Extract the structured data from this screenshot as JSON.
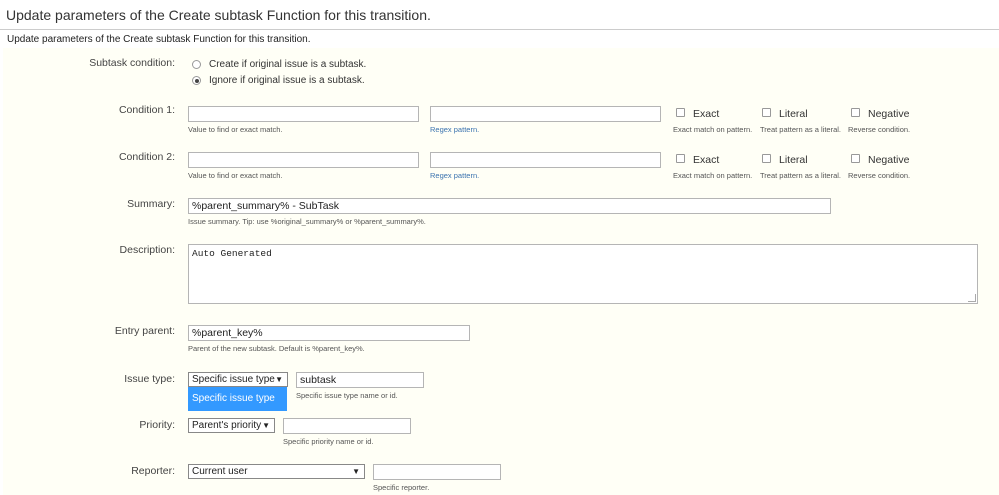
{
  "header": {
    "title": "Update parameters of the Create subtask Function for this transition.",
    "description": "Update parameters of the Create subtask Function for this transition."
  },
  "subtask_condition": {
    "label": "Subtask condition:",
    "options": [
      {
        "label": "Create if original issue is a subtask.",
        "checked": false
      },
      {
        "label": "Ignore if original issue is a subtask.",
        "checked": true
      }
    ]
  },
  "condition1": {
    "label": "Condition 1:",
    "value_hint": "Value to find or exact match.",
    "regex_hint": "Regex pattern.",
    "exact_label": "Exact",
    "exact_hint": "Exact match on pattern.",
    "literal_label": "Literal",
    "literal_hint": "Treat pattern as a literal.",
    "negative_label": "Negative",
    "negative_hint": "Reverse condition."
  },
  "condition2": {
    "label": "Condition 2:",
    "value_hint": "Value to find or exact match.",
    "regex_hint": "Regex pattern.",
    "exact_label": "Exact",
    "exact_hint": "Exact match on pattern.",
    "literal_label": "Literal",
    "literal_hint": "Treat pattern as a literal.",
    "negative_label": "Negative",
    "negative_hint": "Reverse condition."
  },
  "summary": {
    "label": "Summary:",
    "value": "%parent_summary% - SubTask",
    "hint": "Issue summary. Tip: use %original_summary% or %parent_summary%."
  },
  "description": {
    "label": "Description:",
    "value": "Auto Generated"
  },
  "entry_parent": {
    "label": "Entry parent:",
    "value": "%parent_key%",
    "hint": "Parent of the new subtask. Default is %parent_key%."
  },
  "issue_type": {
    "label": "Issue type:",
    "selected": "Specific issue type",
    "dropdown_highlight": "Specific issue type",
    "value": "subtask",
    "hint": "Specific issue type name or id."
  },
  "priority": {
    "label": "Priority:",
    "selected": "Parent's priority",
    "hint": "Specific priority name or id."
  },
  "reporter": {
    "label": "Reporter:",
    "selected": "Current user",
    "hint": "Specific reporter."
  },
  "icons": {
    "dropdown_arrow": "▼"
  },
  "colors": {
    "panel_bg": "#fffff6",
    "highlight": "#3399ff",
    "link": "#3b73af"
  }
}
